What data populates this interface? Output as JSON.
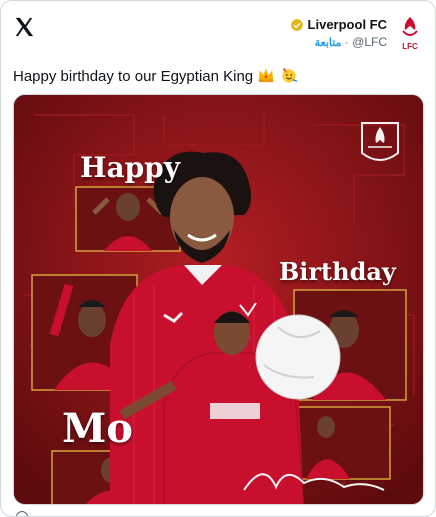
{
  "post": {
    "author_name": "Liverpool FC",
    "handle": "@LFC",
    "follow_label": "متابعة",
    "text": "Happy birthday to our Egyptian King",
    "emojis": [
      "crown-emoji",
      "party-face-emoji"
    ]
  },
  "image": {
    "word_happy": "Happy",
    "word_birthday": "Birthday",
    "word_mo": "Mo",
    "crest_text": "LFC"
  },
  "colors": {
    "lfc_red": "#c8102e",
    "bg_red": "#7d1215",
    "gold": "#d4a23a",
    "verified_gold": "#e2b719",
    "link_blue": "#1d9bf0"
  }
}
